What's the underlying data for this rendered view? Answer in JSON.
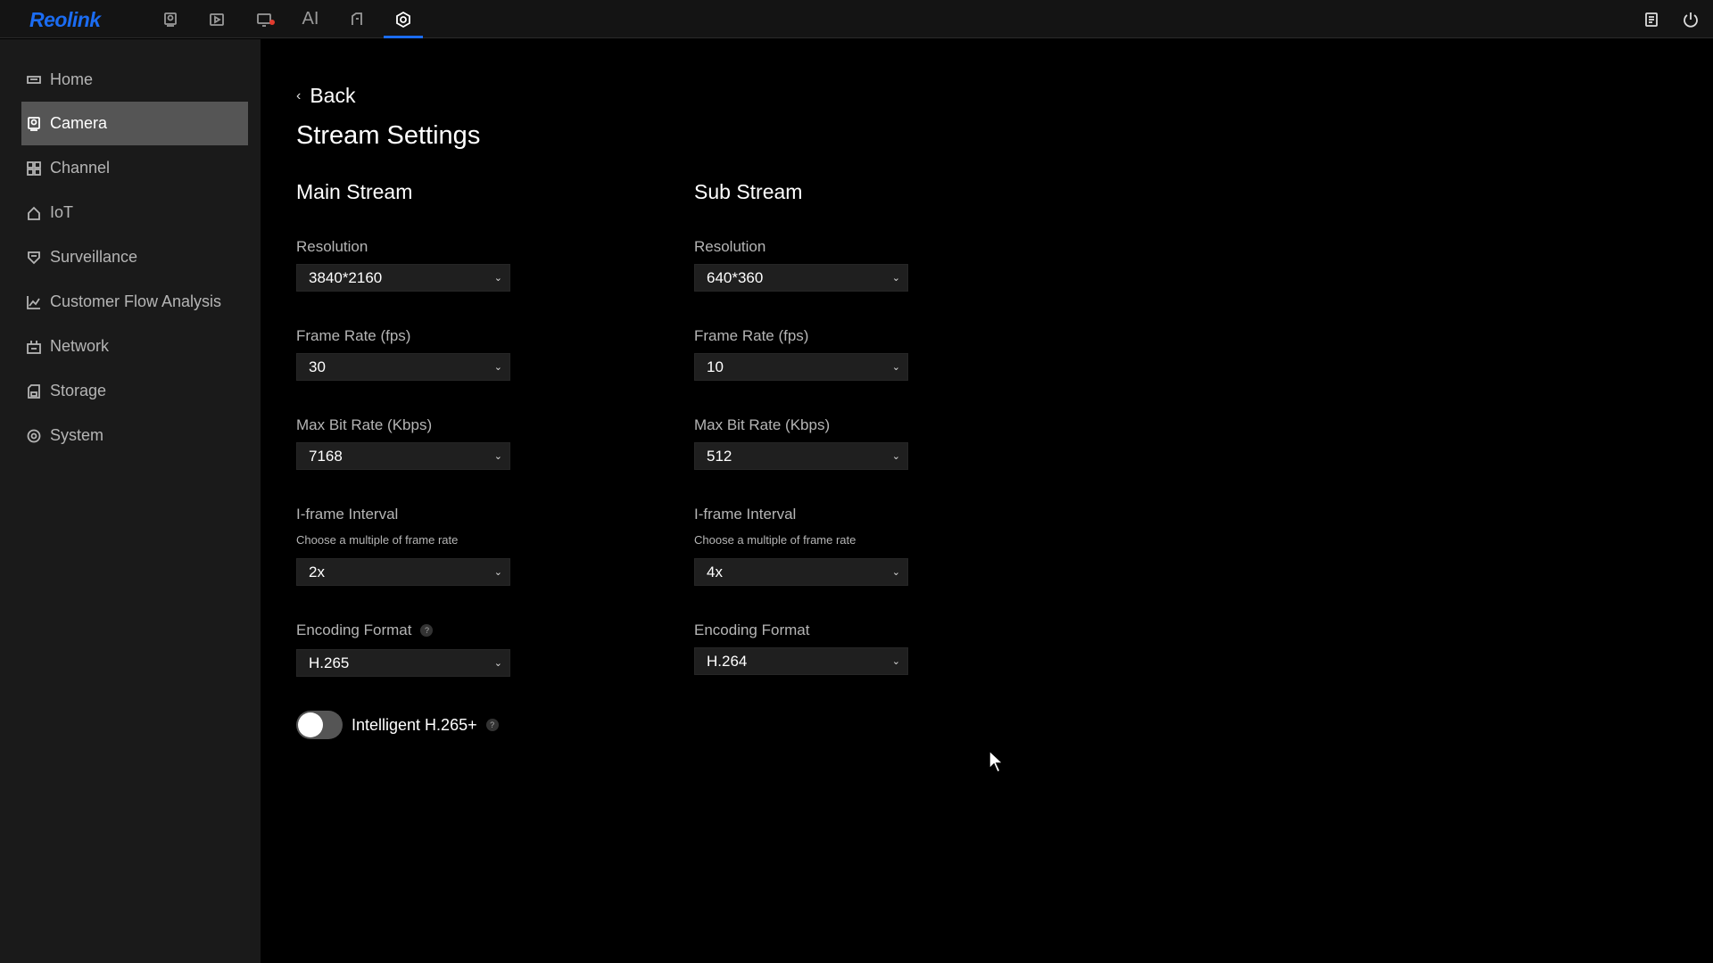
{
  "app": {
    "logo": "Reolink",
    "accent_color": "#1b6cf2"
  },
  "topnav": {
    "items": [
      {
        "name": "camera-live-icon",
        "active": false
      },
      {
        "name": "playback-icon",
        "active": false
      },
      {
        "name": "alarm-icon",
        "active": false
      },
      {
        "name": "ai-icon",
        "label": "AI",
        "active": false
      },
      {
        "name": "device-icon",
        "active": false
      },
      {
        "name": "settings-icon",
        "active": true
      }
    ],
    "right": [
      {
        "name": "notes-icon"
      },
      {
        "name": "power-icon"
      }
    ]
  },
  "sidebar": {
    "items": [
      {
        "label": "Home",
        "icon": "home-icon"
      },
      {
        "label": "Camera",
        "icon": "camera-icon",
        "active": true
      },
      {
        "label": "Channel",
        "icon": "grid-icon"
      },
      {
        "label": "IoT",
        "icon": "iot-icon"
      },
      {
        "label": "Surveillance",
        "icon": "shield-icon"
      },
      {
        "label": "Customer Flow Analysis",
        "icon": "chart-icon"
      },
      {
        "label": "Network",
        "icon": "network-icon"
      },
      {
        "label": "Storage",
        "icon": "storage-icon"
      },
      {
        "label": "System",
        "icon": "system-icon"
      }
    ]
  },
  "page": {
    "back_label": "Back",
    "title": "Stream Settings",
    "main_stream": {
      "title": "Main Stream",
      "resolution_label": "Resolution",
      "resolution_value": "3840*2160",
      "frame_rate_label": "Frame Rate (fps)",
      "frame_rate_value": "30",
      "bitrate_label": "Max Bit Rate (Kbps)",
      "bitrate_value": "7168",
      "iframe_label": "I-frame Interval",
      "iframe_hint": "Choose a multiple of frame rate",
      "iframe_value": "2x",
      "encoding_label": "Encoding Format",
      "encoding_value": "H.265"
    },
    "sub_stream": {
      "title": "Sub Stream",
      "resolution_label": "Resolution",
      "resolution_value": "640*360",
      "frame_rate_label": "Frame Rate (fps)",
      "frame_rate_value": "10",
      "bitrate_label": "Max Bit Rate (Kbps)",
      "bitrate_value": "512",
      "iframe_label": "I-frame Interval",
      "iframe_hint": "Choose a multiple of frame rate",
      "iframe_value": "4x",
      "encoding_label": "Encoding Format",
      "encoding_value": "H.264"
    },
    "toggle": {
      "label": "Intelligent H.265+",
      "enabled": false
    },
    "help_glyph": "?"
  }
}
